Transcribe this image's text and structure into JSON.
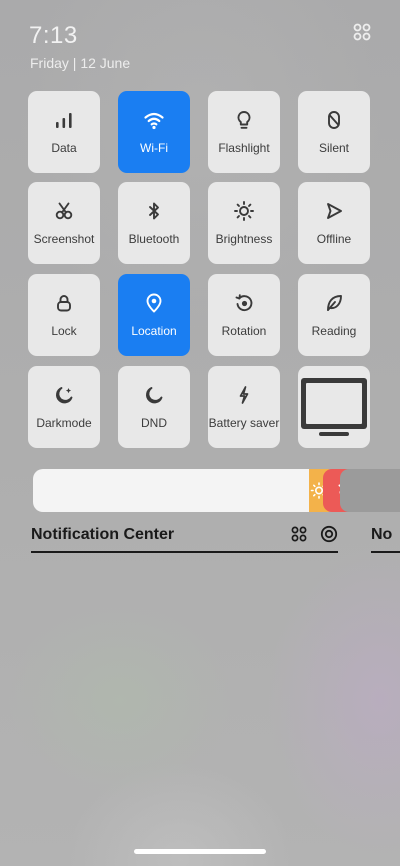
{
  "status": {
    "time": "7:13",
    "date": "Friday | 12 June"
  },
  "tiles": [
    {
      "label": "Data",
      "icon": "signal-icon",
      "active": false
    },
    {
      "label": "Wi-Fi",
      "icon": "wifi-icon",
      "active": true
    },
    {
      "label": "Flashlight",
      "icon": "flashlight-icon",
      "active": false
    },
    {
      "label": "Silent",
      "icon": "silent-icon",
      "active": false
    },
    {
      "label": "Screenshot",
      "icon": "scissors-icon",
      "active": false
    },
    {
      "label": "Bluetooth",
      "icon": "bluetooth-icon",
      "active": false
    },
    {
      "label": "Brightness",
      "icon": "sun-icon",
      "active": false
    },
    {
      "label": "Offline",
      "icon": "airplane-icon",
      "active": false
    },
    {
      "label": "Lock",
      "icon": "lock-icon",
      "active": false
    },
    {
      "label": "Location",
      "icon": "location-icon",
      "active": true
    },
    {
      "label": "Rotation",
      "icon": "rotation-icon",
      "active": false
    },
    {
      "label": "Reading",
      "icon": "leaf-icon",
      "active": false
    },
    {
      "label": "Darkmode",
      "icon": "moon-star-icon",
      "active": false
    },
    {
      "label": "DND",
      "icon": "moon-icon",
      "active": false
    },
    {
      "label": "Battery saver",
      "icon": "bolt-icon",
      "active": false
    }
  ],
  "notifications": {
    "title": "Notification Center",
    "next_title_partial": "No"
  },
  "colors": {
    "active": "#1a7ef2",
    "tile": "#e8e8e8",
    "sun": "#f3b24a",
    "rotation_button": "#ec5a57"
  }
}
